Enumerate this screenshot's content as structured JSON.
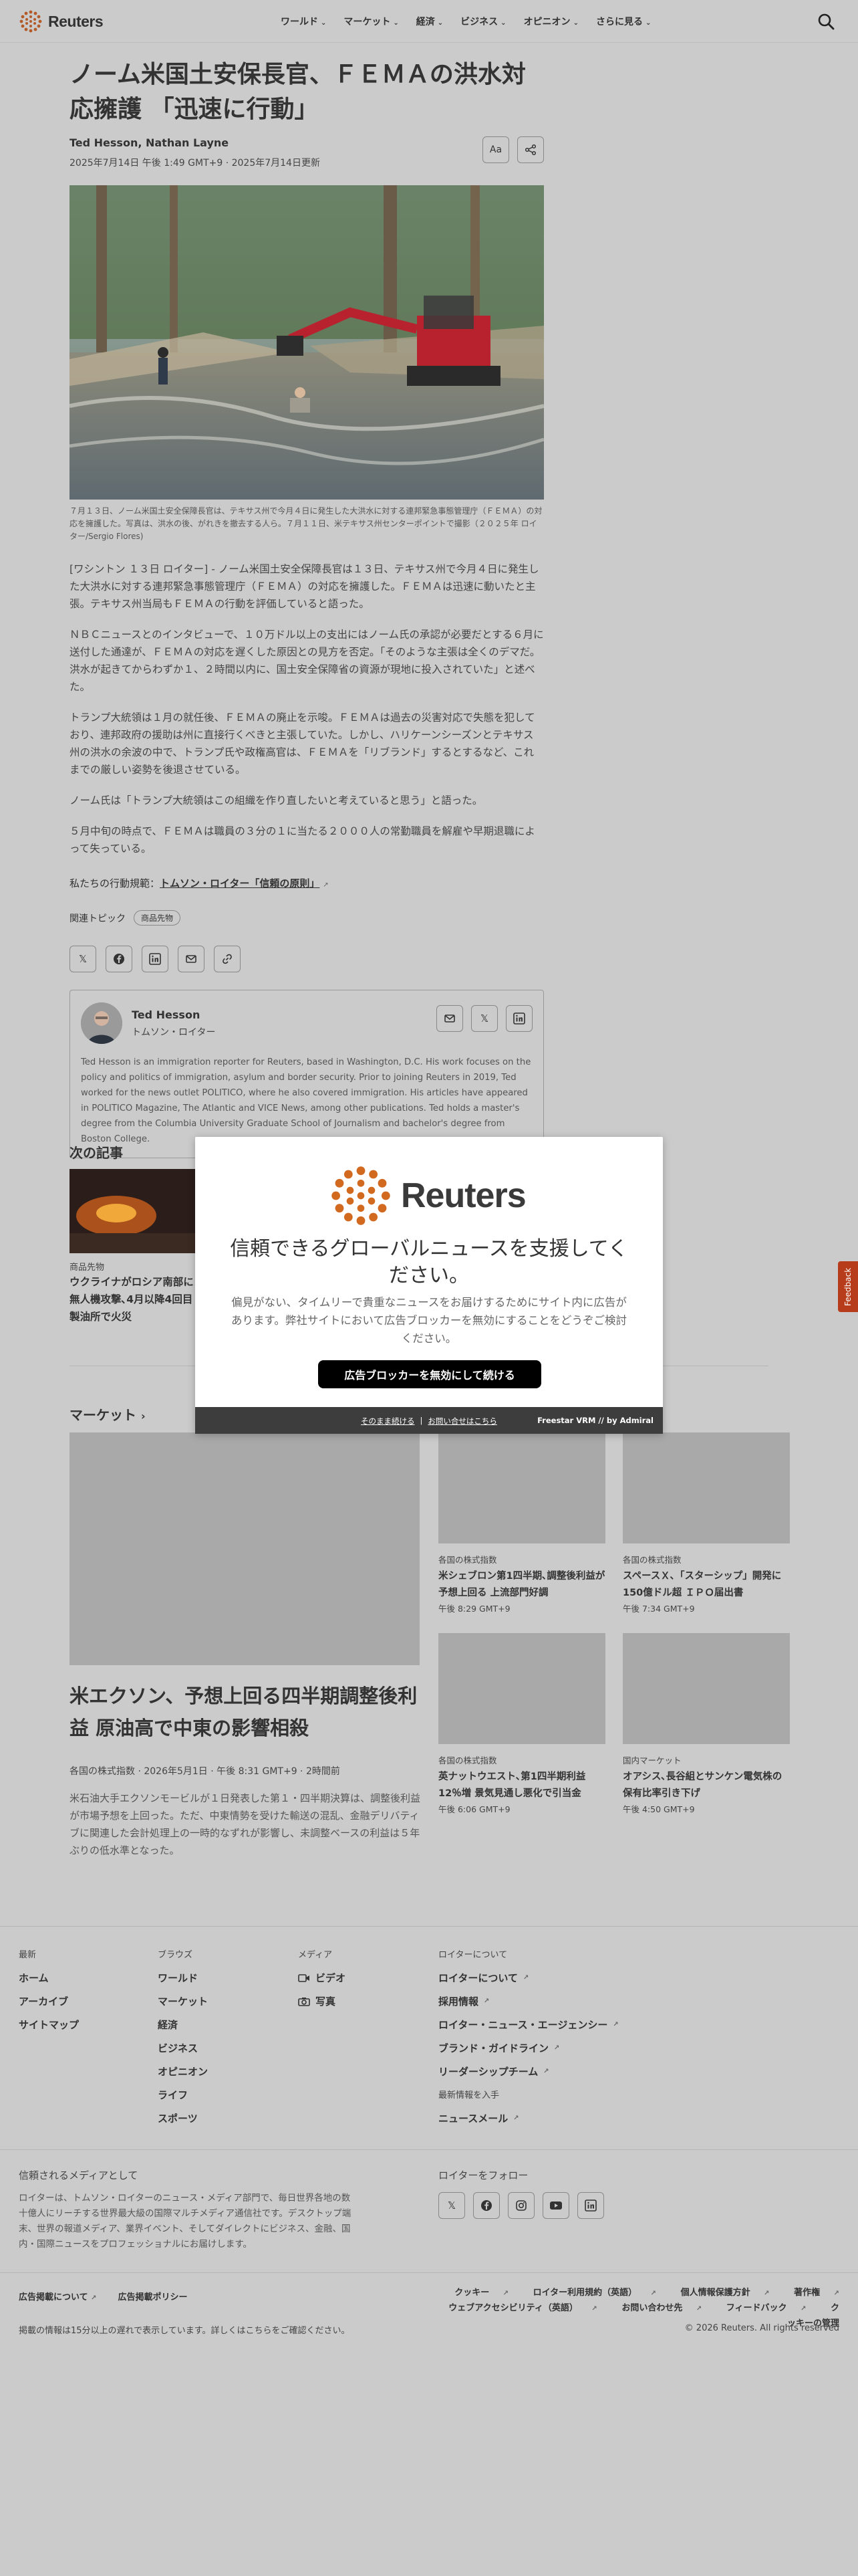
{
  "header": {
    "logo_text": "Reuters",
    "nav": [
      {
        "label": "ワールド"
      },
      {
        "label": "マーケット"
      },
      {
        "label": "経済"
      },
      {
        "label": "ビジネス"
      },
      {
        "label": "オピニオン"
      },
      {
        "label": "さらに見る"
      }
    ]
  },
  "article": {
    "headline": "ノーム米国土安保長官、ＦＥＭＡの洪水対応擁護 「迅速に行動」",
    "authors": "Ted Hesson, Nathan Layne",
    "dateline": "2025年7月14日 午後 1:49 GMT+9 · 2025年7月14日更新",
    "font_button_label": "Aa",
    "caption": "７月１３日、ノーム米国土安全保障長官は、テキサス州で今月４日に発生した大洪水に対する連邦緊急事態管理庁（ＦＥＭＡ）の対応を擁護した。写真は、洪水の後、がれきを撤去する人ら。７月１１日、米テキサス州センターポイントで撮影（２０２５年 ロイター/Sergio Flores)",
    "paragraphs": [
      "[ワシントン １３日 ロイター] - ノーム米国土安全保障長官は１３日、テキサス州で今月４日に発生した大洪水に対する連邦緊急事態管理庁（ＦＥＭＡ）の対応を擁護した。ＦＥＭＡは迅速に動いたと主張。テキサス州当局もＦＥＭＡの行動を評価していると語った。",
      "ＮＢＣニュースとのインタビューで、１０万ドル以上の支出にはノーム氏の承認が必要だとする６月に送付した通達が、ＦＥＭＡの対応を遅くした原因との見方を否定。「そのような主張は全くのデマだ。洪水が起きてからわずか１、２時間以内に、国土安全保障省の資源が現地に投入されていた」と述べた。",
      "トランプ大統領は１月の就任後、ＦＥＭＡの廃止を示唆。ＦＥＭＡは過去の災害対応で失態を犯しており、連邦政府の援助は州に直接行くべきと主張していた。しかし、ハリケーンシーズンとテキサス州の洪水の余波の中で、トランプ氏や政権高官は、ＦＥＭＡを「リブランド」するとするなど、これまでの厳しい姿勢を後退させている。",
      "ノーム氏は「トランプ大統領はこの組織を作り直したいと考えていると思う」と語った。",
      "５月中旬の時点で、ＦＥＭＡは職員の３分の１に当たる２０００人の常勤職員を解雇や早期退職によって失っている。"
    ],
    "principle_prefix": "私たちの行動規範：",
    "principle_link": "トムソン・ロイター「信頼の原則」",
    "topics_label": "関連トピック",
    "topic_chip": "商品先物",
    "author_card": {
      "name": "Ted Hesson",
      "org": "トムソン・ロイター",
      "bio": "Ted Hesson is an immigration reporter for Reuters, based in Washington, D.C. His work focuses on the policy and politics of immigration, asylum and border security. Prior to joining Reuters in 2019, Ted worked for the news outlet POLITICO, where he also covered immigration. His articles have appeared in POLITICO Magazine, The Atlantic and VICE News, among other publications. Ted holds a master's degree from the Columbia University Graduate School of Journalism and bachelor's degree from Boston College."
    }
  },
  "next": {
    "title": "次の記事",
    "kicker": "商品先物",
    "headline": "ウクライナがロシア南部に無人機攻撃､4月以降4回目 製油所で火災"
  },
  "markets": {
    "title": "マーケット",
    "lead": {
      "headline": "米エクソン、予想上回る四半期調整後利益 原油高で中東の影響相殺",
      "meta": "各国の株式指数 · 2026年5月1日 · 午後 8:31 GMT+9 · 2時間前",
      "desc": "米石油大手エクソンモービルが１日発表した第１・四半期決算は、調整後利益が市場予想を上回った。ただ、中東情勢を受けた輸送の混乱、金融デリバティブに関連した会計処理上の一時的なずれが影響し、未調整ベースの利益は５年ぶりの低水準となった。"
    },
    "cards": [
      {
        "kicker": "各国の株式指数",
        "headline": "米シェブロン第1四半期､調整後利益が予想上回る 上流部門好調",
        "time": "午後 8:29 GMT+9"
      },
      {
        "kicker": "各国の株式指数",
        "headline": "スペースＸ､「スターシップ」開発に150億ドル超 ＩＰＯ届出書",
        "time": "午後 7:34 GMT+9"
      },
      {
        "kicker": "各国の株式指数",
        "headline": "英ナットウエスト､第1四半期利益12％増 景気見通し悪化で引当金",
        "time": "午後 6:06 GMT+9"
      },
      {
        "kicker": "国内マーケット",
        "headline": "オアシス､長谷組とサンケン電気株の保有比率引き下げ",
        "time": "午後 4:50 GMT+9"
      }
    ]
  },
  "footer": {
    "col1": {
      "title": "最新",
      "items": [
        "ホーム",
        "アーカイブ",
        "サイトマップ"
      ]
    },
    "col2": {
      "title": "ブラウズ",
      "items": [
        "ワールド",
        "マーケット",
        "経済",
        "ビジネス",
        "オピニオン",
        "ライフ",
        "スポーツ"
      ]
    },
    "col3": {
      "title": "メディア",
      "items": [
        "ビデオ",
        "写真"
      ]
    },
    "col4": {
      "title": "ロイターについて",
      "items": [
        "ロイターについて",
        "採用情報",
        "ロイター・ニュース・エージェンシー",
        "ブランド・ガイドライン",
        "リーダーシップチーム"
      ]
    },
    "col4b": {
      "title": "最新情報を入手",
      "items": [
        "ニュースメール"
      ]
    },
    "trusted_title": "信頼されるメディアとして",
    "trusted_body": "ロイターは、トムソン・ロイターのニュース・メディア部門で、毎日世界各地の数十億人にリーチする世界最大級の国際マルチメディア通信社です。デスクトップ端末、世界の報道メディア、業界イベント、そしてダイレクトにビジネス、金融、国内・国際ニュースをプロフェッショナルにお届けします。",
    "follow_title": "ロイターをフォロー",
    "ad_links": [
      "広告掲載について",
      "広告掲載ポリシー"
    ],
    "legal_row1": [
      "クッキー",
      "ロイター利用規約（英語）",
      "個人情報保護方針",
      "著作権"
    ],
    "legal_row2": [
      "ウェブアクセシビリティ（英語）",
      "お問い合わせ先",
      "フィードバック",
      "クッキーの管理"
    ],
    "delay": "掲載の情報は15分以上の遅れで表示しています。詳しくはこちらをご確認ください。",
    "copyright": "© 2026 Reuters. All rights reserved"
  },
  "feedback_label": "Feedback",
  "modal": {
    "logo_text": "Reuters",
    "title": "信頼できるグローバルニュースを支援してください。",
    "body": "偏見がない、タイムリーで貴重なニュースをお届けするためにサイト内に広告があります。弊社サイトにおいて広告ブロッカーを無効にすることをどうぞご検討ください。",
    "button": "広告ブロッカーを無効にして続ける",
    "link_continue": "そのまま続ける",
    "link_separator": "|",
    "link_contact": "お問い合せはこちら",
    "brand": "Freestar VRM // by Admiral"
  },
  "colors": {
    "brand_orange": "#d1691f",
    "feedback_red": "#b73c1b",
    "modal_button": "#000000"
  }
}
